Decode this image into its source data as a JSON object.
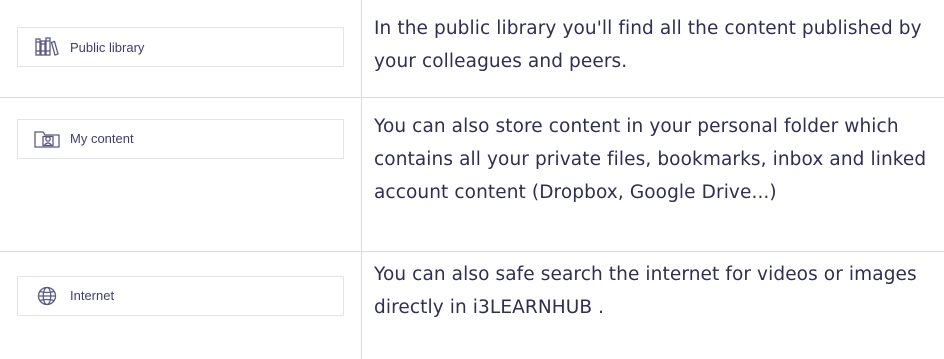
{
  "rows": [
    {
      "button": {
        "label": "Public library",
        "icon": "books-icon"
      },
      "description": "In the public library you'll find all the content published by your colleagues and peers."
    },
    {
      "button": {
        "label": "My content",
        "icon": "folder-user-icon"
      },
      "description": "You can also store content in your personal folder which contains all your private files, bookmarks, inbox and linked account content (Dropbox, Google Drive...)"
    },
    {
      "button": {
        "label": "Internet",
        "icon": "globe-icon"
      },
      "description": "You can also safe search the internet for videos or images directly in i3LEARNHUB ."
    }
  ],
  "colors": {
    "text": "#2f2e54",
    "icon": "#5b5a86",
    "border": "#d9d9df"
  }
}
